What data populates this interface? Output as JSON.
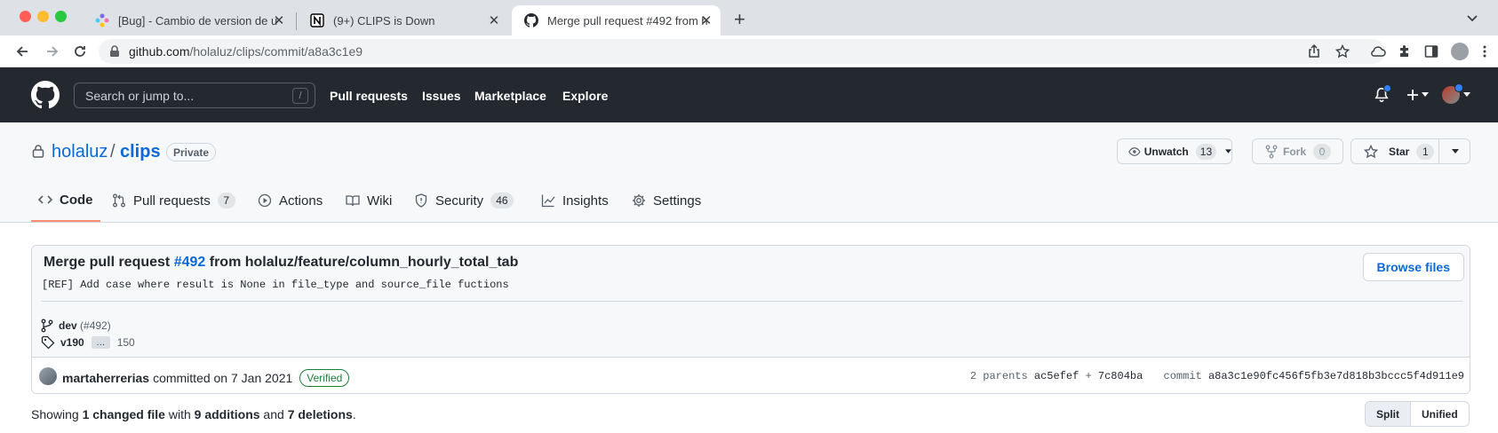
{
  "browser": {
    "tabs": [
      {
        "title": "[Bug] - Cambio de version de u",
        "icon": "clickup-icon",
        "active": false
      },
      {
        "title": "(9+) CLIPS is Down",
        "icon": "notion-icon",
        "active": false
      },
      {
        "title": "Merge pull request #492 from h",
        "icon": "github-icon",
        "active": true
      }
    ],
    "new_tab_label": "+",
    "url_host": "github.com",
    "url_path": "/holaluz/clips/commit/a8a3c1e9"
  },
  "header": {
    "search_placeholder": "Search or jump to...",
    "search_shortcut": "/",
    "nav": [
      "Pull requests",
      "Issues",
      "Marketplace",
      "Explore"
    ]
  },
  "repo": {
    "owner": "holaluz",
    "separator": "/",
    "name": "clips",
    "visibility": "Private",
    "watch_label": "Unwatch",
    "watch_count": "13",
    "fork_label": "Fork",
    "fork_count": "0",
    "star_label": "Star",
    "star_count": "1",
    "tabs": [
      {
        "label": "Code",
        "icon": "code-icon",
        "selected": true
      },
      {
        "label": "Pull requests",
        "icon": "pull-request-icon",
        "count": "7"
      },
      {
        "label": "Actions",
        "icon": "play-icon"
      },
      {
        "label": "Wiki",
        "icon": "book-icon"
      },
      {
        "label": "Security",
        "icon": "shield-icon",
        "count": "46"
      },
      {
        "label": "Insights",
        "icon": "graph-icon"
      },
      {
        "label": "Settings",
        "icon": "gear-icon"
      }
    ]
  },
  "commit": {
    "title_prefix": "Merge pull request ",
    "pr_link": "#492",
    "title_suffix": " from holaluz/feature/column_hourly_total_tab",
    "description": "[REF] Add case where result is None in file_type and source_file fuctions",
    "browse_files_label": "Browse files",
    "branch": "dev",
    "branch_pr": "(#492)",
    "tag": "v190",
    "ellipsis": "…",
    "tag_count": "150",
    "author": "martaherrerias",
    "committed_text": "committed on 7 Jan 2021",
    "verified_label": "Verified",
    "parents_label": "2 parents",
    "parent_1": "ac5efef",
    "parent_join": "+",
    "parent_2": "7c804ba",
    "commit_label": "commit",
    "sha": "a8a3c1e90fc456f5fb3e7d818b3bccc5f4d911e9"
  },
  "summary": {
    "prefix": "Showing ",
    "files": "1 changed file",
    "middle": " with ",
    "additions": "9 additions",
    "and": " and ",
    "deletions": "7 deletions",
    "end": "."
  },
  "view_toggle": {
    "split": "Split",
    "unified": "Unified"
  },
  "colors": {
    "accent": "#0969da",
    "header_bg": "#24292f",
    "tab_underline": "#fd8c73",
    "verified": "#1a7f37"
  }
}
